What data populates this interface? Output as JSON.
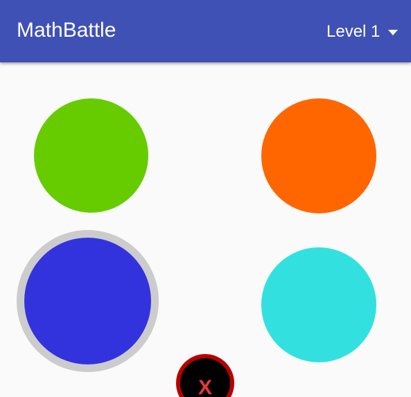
{
  "app_bar": {
    "title": "MathBattle",
    "level_selector": {
      "selected": "Level 1",
      "icon": "dropdown-arrow-icon"
    },
    "color": "#3f51b5"
  },
  "game_board": {
    "circles": [
      {
        "id": "green",
        "color": "#66cc00",
        "selected": false
      },
      {
        "id": "orange",
        "color": "#ff6600",
        "selected": false
      },
      {
        "id": "blue",
        "color": "#3333dd",
        "selected": true,
        "ring_color": "#cccccc"
      },
      {
        "id": "cyan",
        "color": "#33e0e0",
        "selected": false
      }
    ]
  },
  "close_button": {
    "label": "X",
    "icon": "close-icon",
    "ring_color": "#b80000",
    "fill_color": "#000000",
    "text_color": "#e53935"
  }
}
